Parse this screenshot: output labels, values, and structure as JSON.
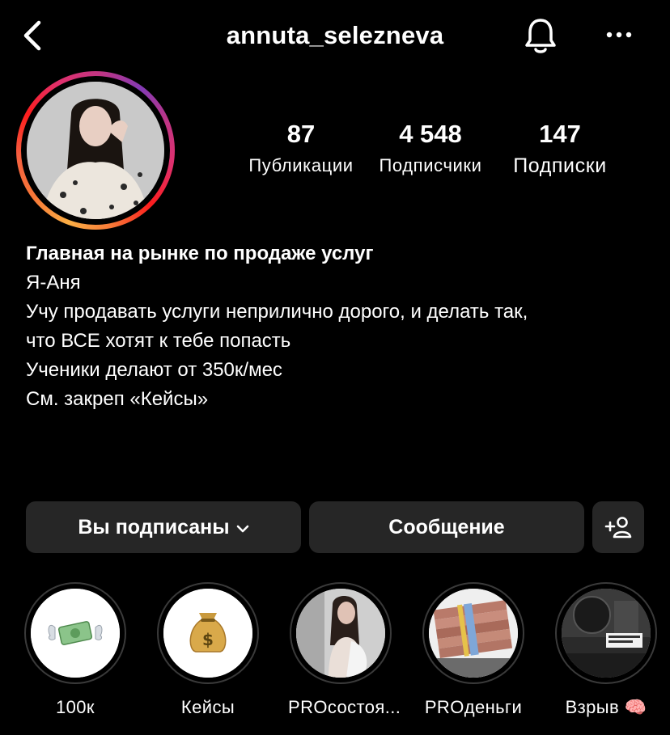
{
  "header": {
    "username": "annuta_selezneva",
    "back_icon": "chevron-left-icon",
    "bell_icon": "bell-icon",
    "more_icon": "more-horizontal-icon"
  },
  "avatar": {
    "ring_colors": [
      "#fcaf45",
      "#f77737",
      "#fd1d1d",
      "#e1306c",
      "#c13584",
      "#833ab4"
    ]
  },
  "stats": [
    {
      "value": "87",
      "label": "Публикации"
    },
    {
      "value": "4 548",
      "label": "Подписчики"
    },
    {
      "value": "147",
      "label": "Подписки"
    }
  ],
  "bio": {
    "title": "Главная на рынке по продаже услуг",
    "lines": [
      "Я-Аня",
      "Учу продавать услуги неприлично дорого, и делать так,",
      "что ВСЕ хотят к тебе попасть",
      "",
      "Ученики делают от 350к/мес",
      "",
      "См. закреп «Кейсы»"
    ]
  },
  "actions": {
    "follow_label": "Вы подписаны",
    "message_label": "Сообщение",
    "add_user_icon": "add-user-icon"
  },
  "highlights": [
    {
      "label": "100к",
      "icon": "money-with-wings-icon"
    },
    {
      "label": "Кейсы",
      "icon": "money-bag-icon"
    },
    {
      "label": "PROсостоя...",
      "icon": "photo-thumbnail"
    },
    {
      "label": "PROденьги",
      "icon": "photo-thumbnail"
    },
    {
      "label": "Взрыв 🧠",
      "icon": "photo-thumbnail"
    }
  ],
  "colors": {
    "background": "#000000",
    "button": "#262626",
    "text": "#ffffff"
  }
}
